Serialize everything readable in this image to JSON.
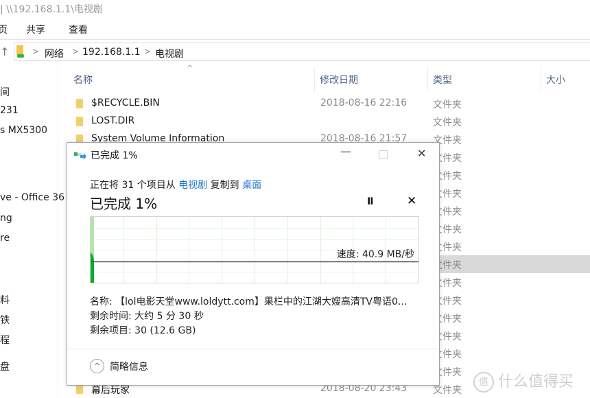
{
  "window": {
    "title_path": "| \\\\192.168.1.1\\电视剧"
  },
  "ribbon": {
    "tabs": [
      "页",
      "共享",
      "查看"
    ]
  },
  "address_bar": {
    "segments": [
      "网络",
      "192.168.1.1",
      "电视剧"
    ],
    "separator": ">"
  },
  "nav": {
    "up_icon": "↑"
  },
  "sidebar": {
    "items": [
      {
        "label": "间",
        "y": 0
      },
      {
        "label": "231"
      },
      {
        "label": "s  MX5300"
      },
      {
        "label": "ve - Office 36"
      },
      {
        "label": "ng"
      },
      {
        "label": "re"
      },
      {
        "label": "料"
      },
      {
        "label": "铁"
      },
      {
        "label": "程"
      },
      {
        "label": "盘"
      }
    ]
  },
  "columns": {
    "name": "名称",
    "date": "修改日期",
    "type": "类型",
    "size": "大小",
    "sort_indicator": "^"
  },
  "files": [
    {
      "name": "$RECYCLE.BIN",
      "date": "2018-08-16 22:16",
      "type": "文件夹"
    },
    {
      "name": "LOST.DIR",
      "date": "",
      "type": "文件夹"
    },
    {
      "name": "System Volume Information",
      "date": "2018-08-16 21:57",
      "type": "文件夹"
    },
    {
      "name": "",
      "date": "",
      "type": "文件夹"
    },
    {
      "name": "",
      "date": "",
      "type": "文件夹"
    },
    {
      "name": "",
      "date": "",
      "type": "文件夹"
    },
    {
      "name": "",
      "date": "",
      "type": "文件夹"
    },
    {
      "name": "",
      "date": "",
      "type": "文件夹"
    },
    {
      "name": "",
      "date": "",
      "type": "文件夹"
    },
    {
      "name": "",
      "date": "",
      "type": "文件夹",
      "selected": true
    },
    {
      "name": "",
      "date": "",
      "type": "文件夹"
    },
    {
      "name": "",
      "date": "",
      "type": "文件夹"
    },
    {
      "name": "",
      "date": "",
      "type": "文件夹"
    },
    {
      "name": "",
      "date": "",
      "type": "文件夹"
    },
    {
      "name": "",
      "date": "",
      "type": "文件夹"
    },
    {
      "name": "",
      "date": "",
      "type": "文件夹"
    },
    {
      "name": "幕后玩家",
      "date": "2018-08-20 23:43",
      "type": "文件夹"
    }
  ],
  "dialog": {
    "title": "已完成 1%",
    "minimize": "—",
    "close": "✕",
    "desc_prefix": "正在将 31 个项目从 ",
    "desc_source": "电视剧",
    "desc_mid": " 复制到 ",
    "desc_dest": "桌面",
    "progress_text": "已完成 1%",
    "progress_percent": 1,
    "pause": "II",
    "stop": "✕",
    "speed": "速度: 40.9 MB/秒",
    "name_line": "名称: 【lol电影天堂www.loldytt.com】果栏中的江湖大嫂高清TV粤语0...",
    "time_left": "剩余时间: 大约 5 分 30 秒",
    "items_left": "剩余项目: 30 (12.6 GB)",
    "more_details": "简略信息",
    "more_icon": "^"
  },
  "watermark": {
    "icon": "值",
    "text": "什么值得买"
  },
  "colors": {
    "link": "#1f77c9",
    "graph_fill": "#06b025",
    "graph_fill_light": "#b2e7a6",
    "grid": "#dff3df",
    "selected_row": "#d9d9d9"
  }
}
